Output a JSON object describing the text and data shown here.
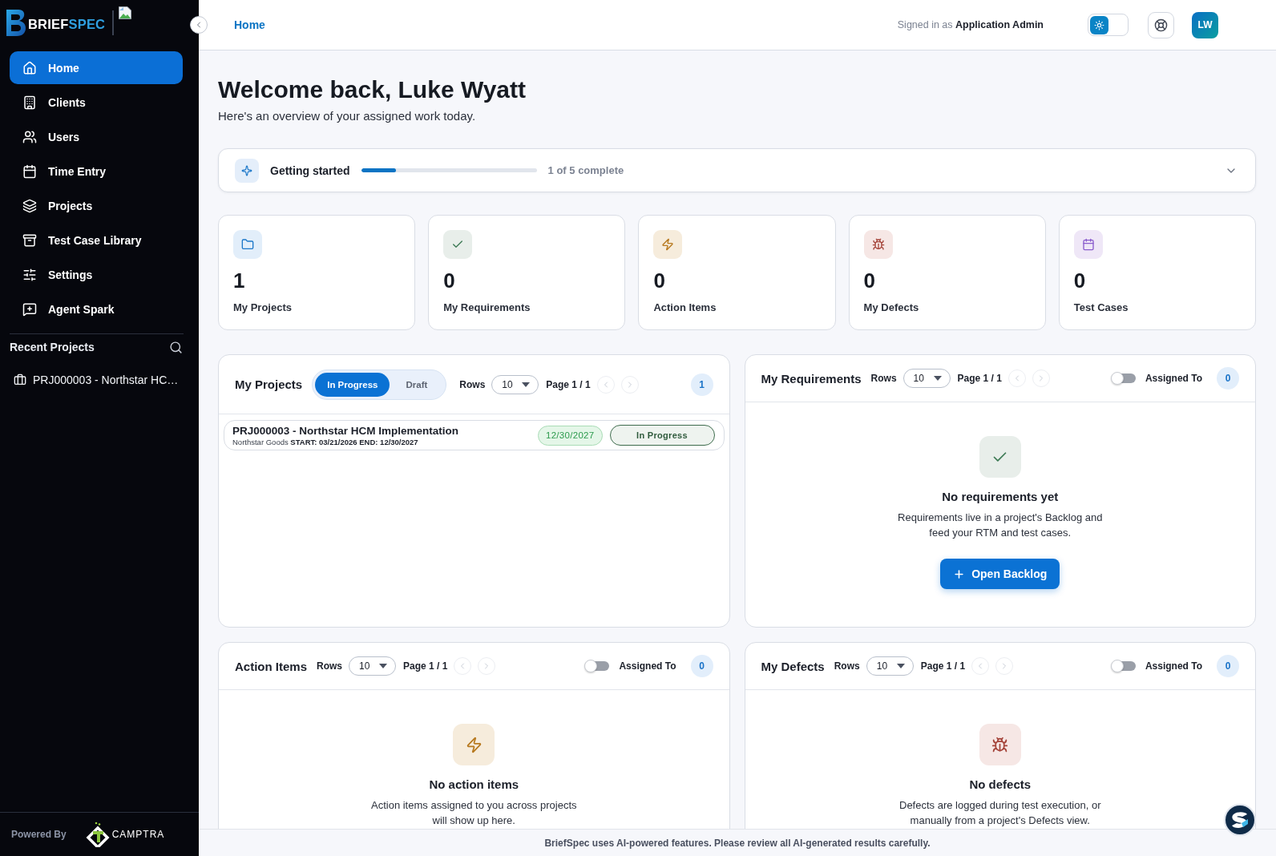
{
  "sidebar": {
    "logo": {
      "parts": [
        {
          "text": "BRIEF",
          "kind": "plain"
        },
        {
          "text": "SPEC",
          "kind": "accent"
        }
      ]
    },
    "items": [
      {
        "label": "Home",
        "kind": "home",
        "selected": true
      },
      {
        "label": "Clients",
        "kind": "clients",
        "selected": false
      },
      {
        "label": "Users",
        "kind": "users",
        "selected": false
      },
      {
        "label": "Time Entry",
        "kind": "time",
        "selected": false
      },
      {
        "label": "Projects",
        "kind": "projects",
        "selected": false
      },
      {
        "label": "Test Case Library",
        "kind": "library",
        "selected": false
      },
      {
        "label": "Settings",
        "kind": "settings",
        "selected": false
      },
      {
        "label": "Agent Spark",
        "kind": "agent",
        "selected": false
      }
    ],
    "recent_title": "Recent Projects",
    "recent_projects": [
      {
        "label": "PRJ000003 - Northstar HC…"
      }
    ],
    "powered_by": "Powered By",
    "partner_logo": "CAMPTRA"
  },
  "top_bar": {
    "breadcrumb": "Home",
    "signed_in": "Signed in as **Application Admin**",
    "dark_mode": false,
    "avatar_initials": "LW"
  },
  "welcome": {
    "title": "Welcome back, Luke Wyatt",
    "subtitle": "Here's an overview of your assigned work today."
  },
  "getting_started": {
    "title": "Getting started",
    "level": 0.2,
    "progress_text": "1 of 5 complete",
    "expanded": false
  },
  "stats": [
    {
      "kind": "folder",
      "value": "1",
      "label": "My Projects"
    },
    {
      "kind": "check",
      "value": "0",
      "label": "My Requirements"
    },
    {
      "kind": "bolt",
      "value": "0",
      "label": "Action Items"
    },
    {
      "kind": "bug",
      "value": "0",
      "label": "My Defects"
    },
    {
      "kind": "calendar",
      "value": "0",
      "label": "Test Cases"
    }
  ],
  "my_projects": {
    "title": "My Projects",
    "tabs": [
      {
        "label": "In Progress",
        "selected": true
      },
      {
        "label": "Draft",
        "selected": false
      }
    ],
    "rows_label": "Rows",
    "rows_value": "10",
    "page": "Page 1 / 1",
    "pager": {
      "prev": {
        "disabled": true
      },
      "next": {
        "disabled": true
      }
    },
    "count": "1",
    "projects": [
      {
        "name": "PRJ000003 - Northstar HCM Implementation",
        "details": "Northstar Goods **START: 03/21/2026 END: 12/30/2027**",
        "due": "12/30/2027",
        "status": "In Progress"
      }
    ]
  },
  "my_requirements": {
    "title": "My Requirements",
    "rows_label": "Rows",
    "rows_value": "10",
    "page": "Page 1 / 1",
    "pager": {
      "prev": {
        "disabled": true
      },
      "next": {
        "disabled": true
      }
    },
    "assigned_to": {
      "label": "Assigned To",
      "on": false
    },
    "count": "0",
    "empty": {
      "kind": "check",
      "title": "No requirements yet",
      "text": "Requirements live in a project's Backlog and feed your RTM and test cases.",
      "action": "Open Backlog"
    }
  },
  "action_items": {
    "title": "Action Items",
    "rows_label": "Rows",
    "rows_value": "10",
    "page": "Page 1 / 1",
    "pager": {
      "prev": {
        "disabled": true
      },
      "next": {
        "disabled": true
      }
    },
    "assigned_to": {
      "label": "Assigned To",
      "on": false
    },
    "count": "0",
    "empty": {
      "kind": "bolt",
      "title": "No action items",
      "text": "Action items assigned to you across projects will show up here."
    }
  },
  "my_defects": {
    "title": "My Defects",
    "rows_label": "Rows",
    "rows_value": "10",
    "page": "Page 1 / 1",
    "pager": {
      "prev": {
        "disabled": true
      },
      "next": {
        "disabled": true
      }
    },
    "assigned_to": {
      "label": "Assigned To",
      "on": false
    },
    "count": "0",
    "empty": {
      "kind": "bug",
      "title": "No defects",
      "text": "Defects are logged during test execution, or manually from a project's Defects view."
    }
  },
  "footer": {
    "notice": "BriefSpec uses AI-powered features. Please review all AI-generated results carefully."
  }
}
